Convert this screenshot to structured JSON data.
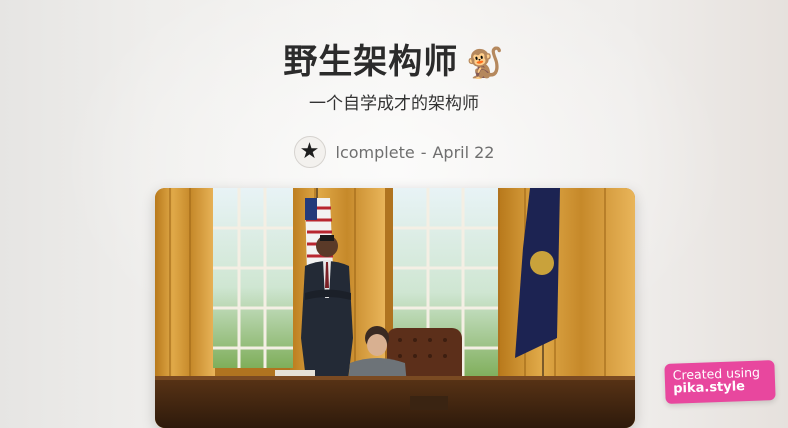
{
  "post": {
    "title": "野生架构师",
    "title_emoji": "🐒",
    "subtitle": "一个自学成才的架构师",
    "author_icon": "star-logo-icon",
    "author": "lcomplete",
    "separator": "-",
    "date": "April 22"
  },
  "image": {
    "description_name": "oval-office-photo"
  },
  "badge": {
    "line1": "Created using",
    "line2": "pika.style"
  },
  "colors": {
    "badge_bg": "#e8479e",
    "title": "#2b2b2b",
    "meta_text": "#6f6f6f"
  }
}
